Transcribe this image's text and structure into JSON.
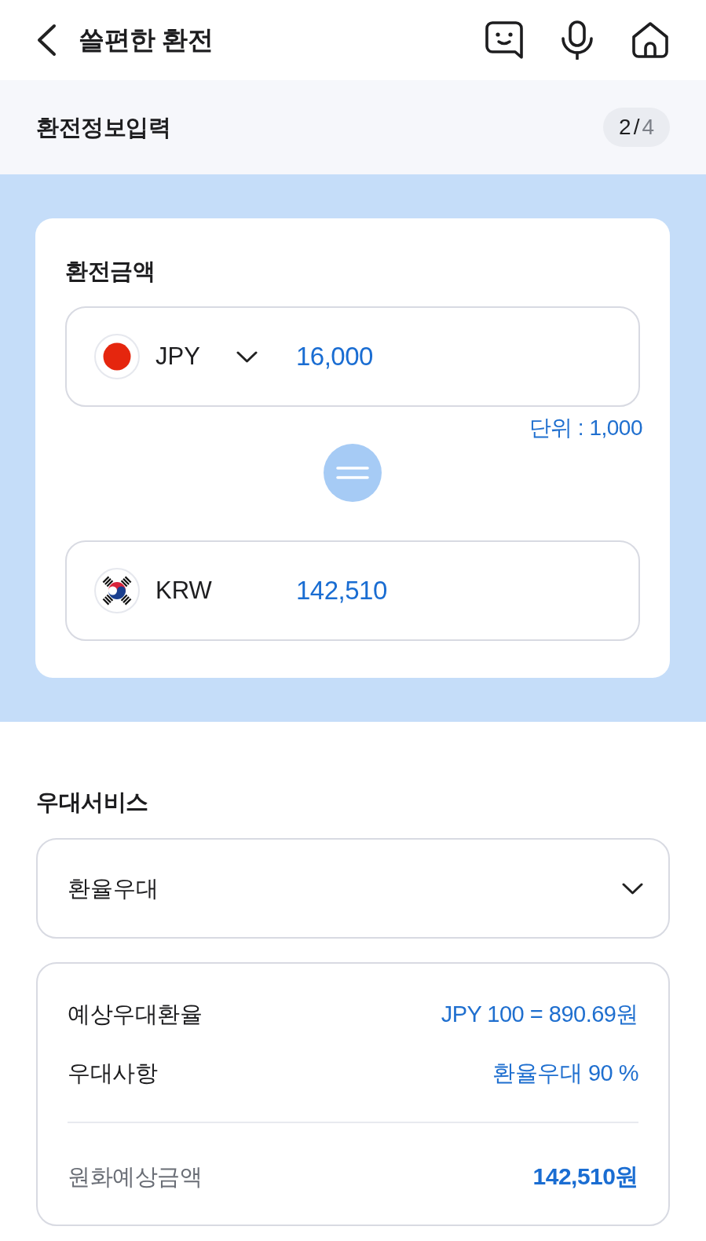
{
  "header": {
    "title": "쓸편한 환전"
  },
  "step": {
    "title": "환전정보입력",
    "current": "2",
    "separator": "/",
    "total": "4"
  },
  "exchange": {
    "title": "환전금액",
    "from": {
      "currency": "JPY",
      "amount": "16,000",
      "selectable": true
    },
    "unit_note": "단위 : 1,000",
    "to": {
      "currency": "KRW",
      "amount": "142,510",
      "selectable": false
    }
  },
  "benefits": {
    "title": "우대서비스",
    "dropdown": {
      "value": "환율우대"
    },
    "details": [
      {
        "label": "예상우대환율",
        "value": "JPY 100 = 890.69원"
      },
      {
        "label": "우대사항",
        "value": "환율우대 90 %"
      }
    ],
    "total": {
      "label": "원화예상금액",
      "value": "142,510원"
    }
  }
}
